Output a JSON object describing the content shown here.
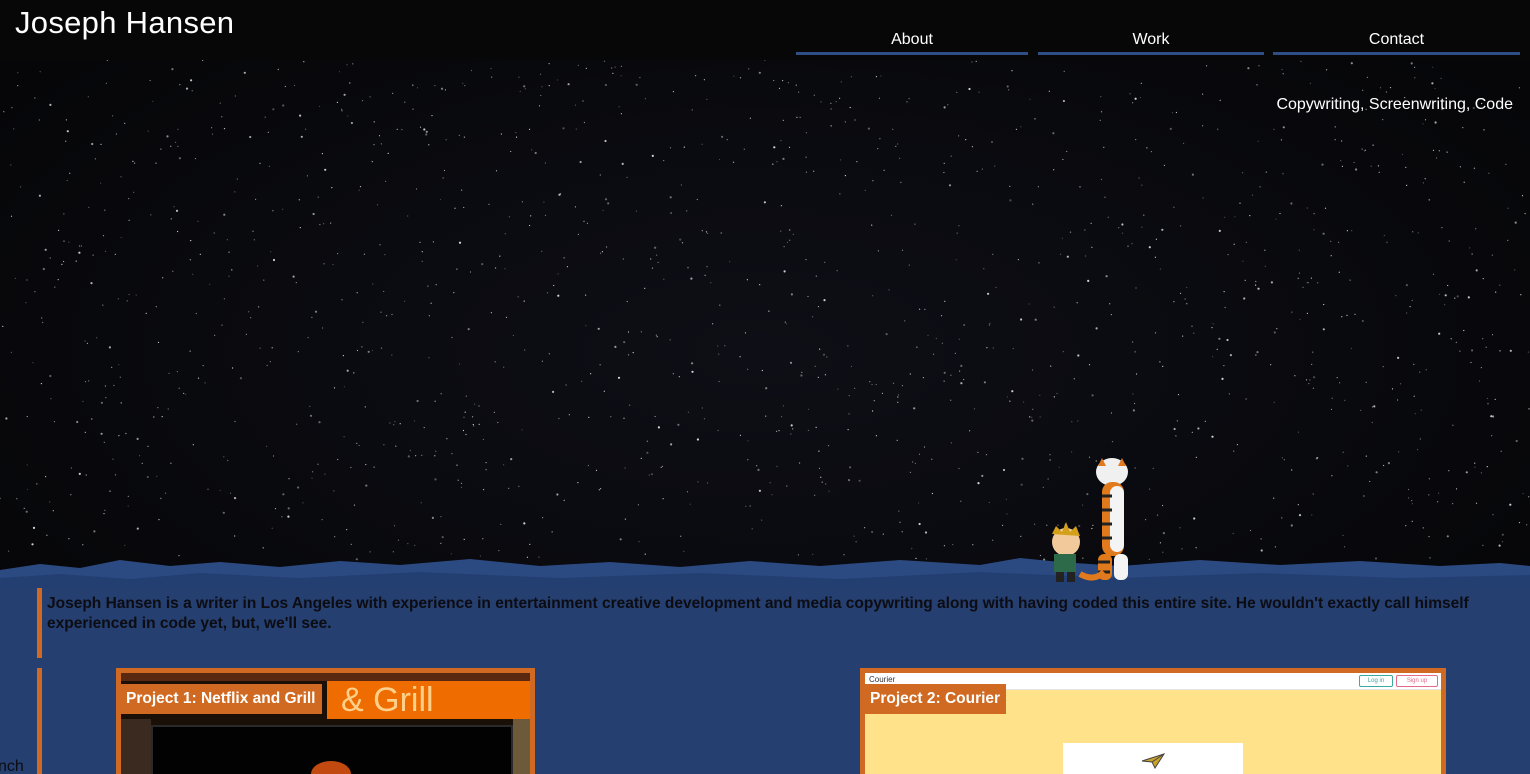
{
  "header": {
    "site_title": "Joseph Hansen",
    "nav": [
      {
        "label": "About"
      },
      {
        "label": "Work"
      },
      {
        "label": "Contact"
      }
    ],
    "tagline": "Copywriting, Screenwriting, Code"
  },
  "colors": {
    "accent_orange": "#d06a22",
    "nav_underline": "#2f4e86",
    "content_bg": "#243f70"
  },
  "bio": {
    "text": "Joseph Hansen is a writer in Los Angeles with experience in entertainment creative development and media copywriting along with having coded this entire site. He wouldn't exactly call himself experienced in code yet, but, we'll see."
  },
  "cut_text": "nch",
  "projects": [
    {
      "label": "Project 1: Netflix and Grill",
      "banner_text": "& Grill"
    },
    {
      "label": "Project 2: Courier",
      "app_logo": "Courier",
      "login": "Log in",
      "signup": "Sign up"
    }
  ],
  "icons": {
    "plane": "paper-plane-icon"
  }
}
